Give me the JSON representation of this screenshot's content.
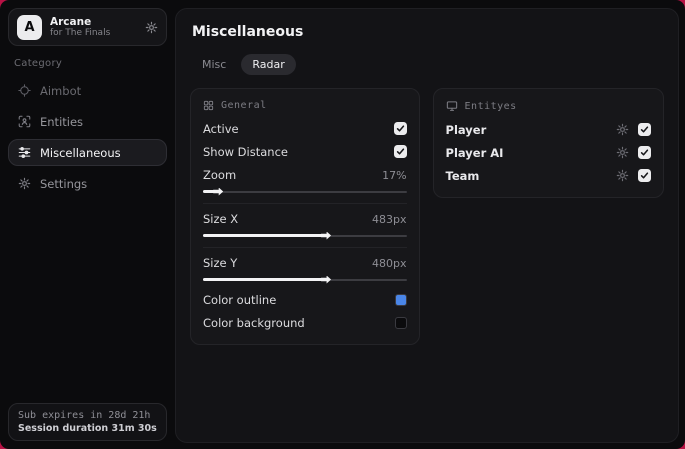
{
  "app": {
    "title": "Arcane",
    "subtitle": "for The Finals",
    "logo_letter": "A"
  },
  "sidebar": {
    "category_label": "Category",
    "items": [
      {
        "label": "Aimbot",
        "icon": "crosshair-icon",
        "active": false
      },
      {
        "label": "Entities",
        "icon": "scan-icon",
        "active": false
      },
      {
        "label": "Miscellaneous",
        "icon": "sliders-icon",
        "active": true
      },
      {
        "label": "Settings",
        "icon": "gear-icon",
        "active": false
      }
    ],
    "footer": {
      "sub_expires": "Sub expires in 28d 21h",
      "session_duration": "Session duration 31m 30s"
    }
  },
  "main": {
    "page_title": "Miscellaneous",
    "tabs": [
      {
        "label": "Misc",
        "active": false
      },
      {
        "label": "Radar",
        "active": true
      }
    ],
    "general": {
      "title": "General",
      "active_label": "Active",
      "active_checked": true,
      "show_distance_label": "Show Distance",
      "show_distance_checked": true,
      "zoom_label": "Zoom",
      "zoom_value": "17%",
      "zoom_fill_pct": 6,
      "size_x_label": "Size X",
      "size_x_value": "483px",
      "size_x_fill_pct": 59,
      "size_y_label": "Size Y",
      "size_y_value": "480px",
      "size_y_fill_pct": 59,
      "color_outline_label": "Color outline",
      "color_outline_value": "#4a86e8",
      "color_background_label": "Color background",
      "color_background_value": "#0b0b0d"
    },
    "entities": {
      "title": "Entityes",
      "rows": [
        {
          "label": "Player",
          "checked": true
        },
        {
          "label": "Player AI",
          "checked": true
        },
        {
          "label": "Team",
          "checked": true
        }
      ]
    }
  },
  "colors": {
    "desktop_background": "#b81245",
    "accent_blue": "#4a86e8",
    "window_background": "#0b0b0d"
  }
}
